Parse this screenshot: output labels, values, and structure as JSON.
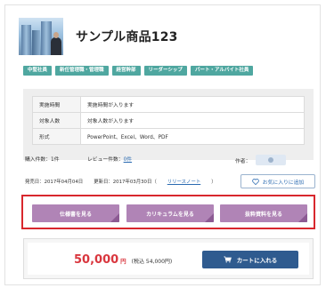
{
  "product": {
    "title": "サンプル商品123"
  },
  "tags": [
    "中堅社員",
    "新任管理職・管理職",
    "経営幹部",
    "リーダーシップ",
    "パート・アルバイト社員"
  ],
  "info_rows": [
    {
      "label": "実施時間",
      "value": "実施時間が入ります"
    },
    {
      "label": "対象人数",
      "value": "対象人数が入ります"
    },
    {
      "label": "形式",
      "value": "PowerPoint、Excel、Word、PDF"
    }
  ],
  "stats": {
    "purchase_label": "購入件数：",
    "purchase_count": "1件",
    "review_label": "レビュー件数：",
    "review_count": "0件",
    "author_label": "作者："
  },
  "dates": {
    "published": "発売日：2017年04月04日",
    "updated_label": "更新日：2017年03月30日（",
    "release_note": "リリースノート",
    "updated_close": "）"
  },
  "favorite": {
    "label": "お気に入りに追加",
    "icon": "heart-icon"
  },
  "doc_buttons": {
    "spec": "仕様書を見る",
    "curriculum": "カリキュラムを見る",
    "excerpt": "抜粋資料を見る"
  },
  "price": {
    "amount": "50,000",
    "unit": "円",
    "tax_note": "(税込 54,000円)"
  },
  "cart": {
    "label": "カートに入れる",
    "icon": "cart-icon"
  },
  "colors": {
    "tag": "#4fa7a0",
    "doc_button": "#b084b6",
    "highlight_border": "#d8272d",
    "price": "#d9363e",
    "cart_button": "#2f5b8f"
  }
}
